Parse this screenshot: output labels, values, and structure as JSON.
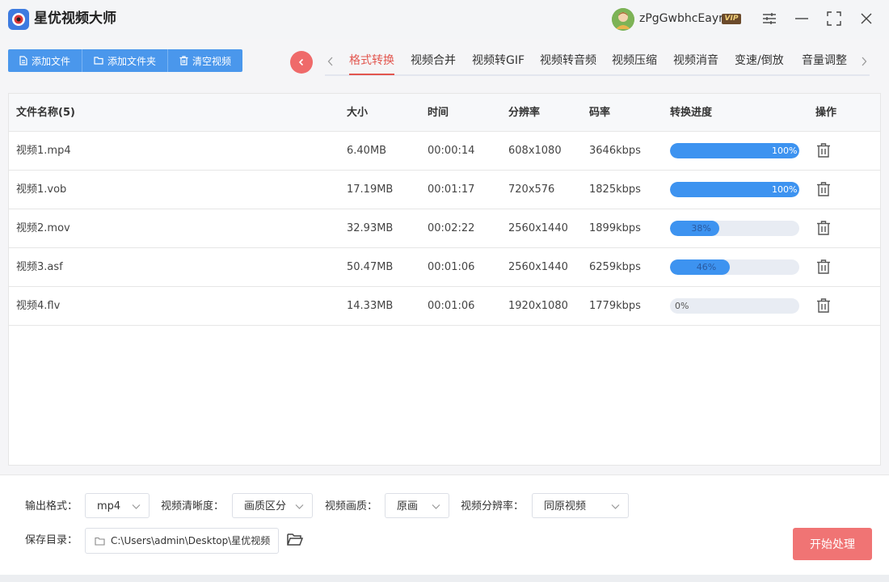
{
  "app": {
    "title": "星优视频大师"
  },
  "user": {
    "name": "zPgGwbhcEayr",
    "badge": "VIP"
  },
  "toolbar": {
    "add_file": "添加文件",
    "add_folder": "添加文件夹",
    "clear_videos": "清空视频"
  },
  "tabs": [
    {
      "label": "格式转换",
      "active": true
    },
    {
      "label": "视频合并"
    },
    {
      "label": "视频转GIF"
    },
    {
      "label": "视频转音频"
    },
    {
      "label": "视频压缩"
    },
    {
      "label": "视频消音"
    },
    {
      "label": "变速/倒放"
    },
    {
      "label": "音量调整"
    }
  ],
  "table": {
    "headers": {
      "name": "文件名称(5)",
      "size": "大小",
      "time": "时间",
      "resolution": "分辨率",
      "bitrate": "码率",
      "progress": "转换进度",
      "action": "操作"
    },
    "rows": [
      {
        "name": "视频1.mp4",
        "size": "6.40MB",
        "time": "00:00:14",
        "resolution": "608x1080",
        "bitrate": "3646kbps",
        "progress": 100,
        "progress_label": "100%"
      },
      {
        "name": "视频1.vob",
        "size": "17.19MB",
        "time": "00:01:17",
        "resolution": "720x576",
        "bitrate": "1825kbps",
        "progress": 100,
        "progress_label": "100%"
      },
      {
        "name": "视频2.mov",
        "size": "32.93MB",
        "time": "00:02:22",
        "resolution": "2560x1440",
        "bitrate": "1899kbps",
        "progress": 38,
        "progress_label": "38%"
      },
      {
        "name": "视频3.asf",
        "size": "50.47MB",
        "time": "00:01:06",
        "resolution": "2560x1440",
        "bitrate": "6259kbps",
        "progress": 46,
        "progress_label": "46%"
      },
      {
        "name": "视频4.flv",
        "size": "14.33MB",
        "time": "00:01:06",
        "resolution": "1920x1080",
        "bitrate": "1779kbps",
        "progress": 0,
        "progress_label": "0%"
      }
    ]
  },
  "settings": {
    "format_label": "输出格式：",
    "format_value": "mp4",
    "clarity_label": "视频清晰度：",
    "clarity_value": "画质区分",
    "quality_label": "视频画质：",
    "quality_value": "原画",
    "resolution_label": "视频分辨率：",
    "resolution_value": "同原视频",
    "save_dir_label": "保存目录：",
    "save_dir_value": "C:\\Users\\admin\\Desktop\\星优视频",
    "start_button": "开始处理"
  },
  "colors": {
    "accent_blue": "#4a97ec",
    "progress_blue": "#3d93f0",
    "accent_red": "#e2564f",
    "start_button": "#f07474"
  }
}
